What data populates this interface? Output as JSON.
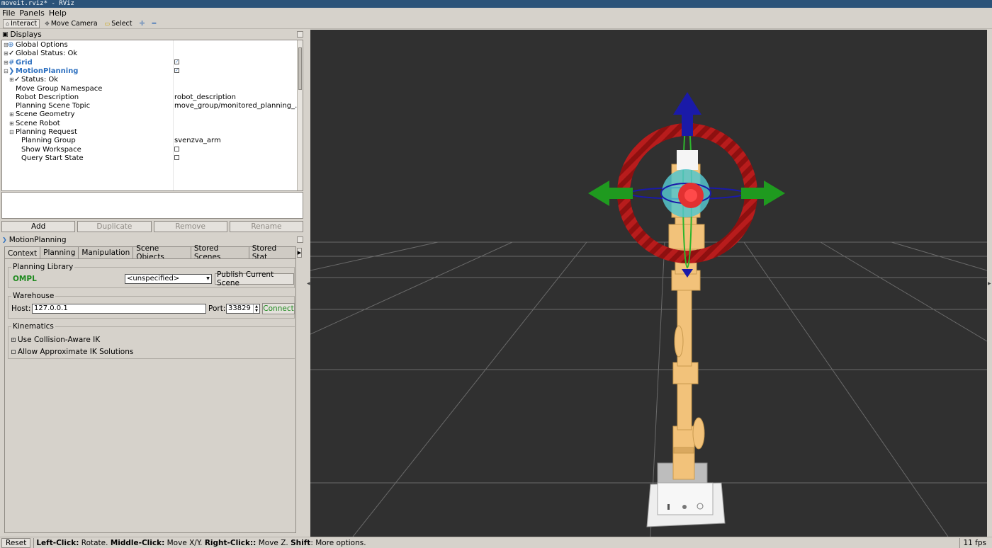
{
  "window": {
    "title": "moveit.rviz* - RViz"
  },
  "menu": {
    "items": [
      "File",
      "Panels",
      "Help"
    ]
  },
  "toolbar": {
    "interact": "Interact",
    "move_camera": "Move Camera",
    "select": "Select",
    "add_icon": "plus-icon",
    "remove_icon": "minus-icon"
  },
  "displays": {
    "title": "Displays",
    "rows": [
      {
        "name": "Global Options",
        "value": ""
      },
      {
        "name": "Global Status: Ok",
        "value": ""
      },
      {
        "name": "Grid",
        "value": ""
      },
      {
        "name": "MotionPlanning",
        "value": ""
      },
      {
        "name": "Status: Ok",
        "value": ""
      },
      {
        "name": "Move Group Namespace",
        "value": ""
      },
      {
        "name": "Robot Description",
        "value": "robot_description"
      },
      {
        "name": "Planning Scene Topic",
        "value": "move_group/monitored_planning_..."
      },
      {
        "name": "Scene Geometry",
        "value": ""
      },
      {
        "name": "Scene Robot",
        "value": ""
      },
      {
        "name": "Planning Request",
        "value": ""
      },
      {
        "name": "Planning Group",
        "value": "svenzva_arm"
      },
      {
        "name": "Show Workspace",
        "value": ""
      },
      {
        "name": "Query Start State",
        "value": ""
      }
    ],
    "buttons": {
      "add": "Add",
      "duplicate": "Duplicate",
      "remove": "Remove",
      "rename": "Rename"
    }
  },
  "motion_planning": {
    "title": "MotionPlanning",
    "tabs": [
      "Context",
      "Planning",
      "Manipulation",
      "Scene Objects",
      "Stored Scenes",
      "Stored Stat"
    ],
    "planning_library": {
      "title": "Planning Library",
      "library": "OMPL",
      "planner": "<unspecified>",
      "publish_button": "Publish Current Scene"
    },
    "warehouse": {
      "title": "Warehouse",
      "host_label": "Host:",
      "host": "127.0.0.1",
      "port_label": "Port:",
      "port": "33829",
      "connect_button": "Connect"
    },
    "kinematics": {
      "title": "Kinematics",
      "collision_aware": "Use Collision-Aware IK",
      "approximate": "Allow Approximate IK Solutions"
    }
  },
  "status": {
    "reset": "Reset",
    "left_click_label": "Left-Click:",
    "left_click_text": " Rotate. ",
    "middle_click_label": "Middle-Click:",
    "middle_click_text": " Move X/Y. ",
    "right_click_label": "Right-Click::",
    "right_click_text": " Move Z. ",
    "shift_label": "Shift",
    "shift_text": ": More options.",
    "fps": "11 fps"
  },
  "colors": {
    "view_bg": "#303030",
    "arrow_blue": "#1a1aa8",
    "arrow_green": "#1f9a1f",
    "ring_red": "#8e1010",
    "robot": "#f2c27a",
    "link_blue": "#2c6fbf",
    "ompl_green": "#1e8a1e"
  }
}
